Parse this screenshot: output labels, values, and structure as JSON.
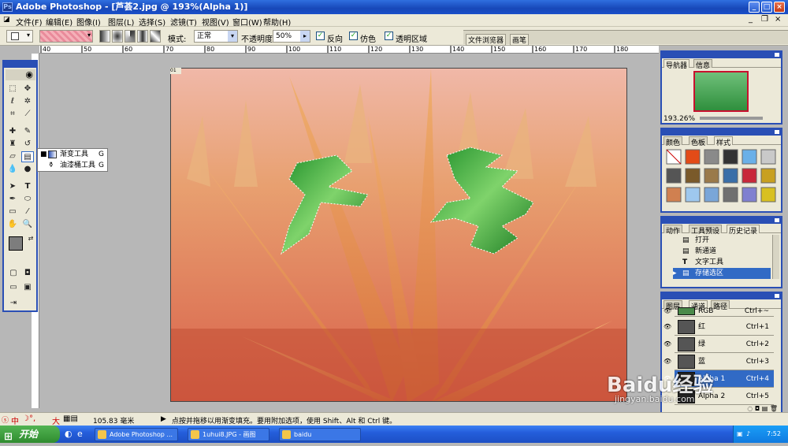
{
  "window": {
    "title": "Adobe Photoshop - [芦荟2.jpg @ 193%(Alpha 1)]"
  },
  "menu": [
    "文件(F)",
    "编辑(E)",
    "图像(I)",
    "图层(L)",
    "选择(S)",
    "滤镜(T)",
    "视图(V)",
    "窗口(W)",
    "帮助(H)"
  ],
  "options": {
    "mode_label": "模式:",
    "mode_value": "正常",
    "opacity_label": "不透明度:",
    "opacity_value": "50%",
    "reverse_label": "反向",
    "dither_label": "仿色",
    "transparency_label": "透明区域",
    "palette_tab1": "文件浏览器",
    "palette_tab2": "画笔"
  },
  "ruler_ticks": [
    "40",
    "50",
    "60",
    "70",
    "80",
    "90",
    "100",
    "110",
    "120",
    "130",
    "140",
    "150",
    "160",
    "170",
    "180"
  ],
  "flyout": {
    "item1_label": "渐变工具",
    "item1_key": "G",
    "item2_label": "油漆桶工具",
    "item2_key": "G"
  },
  "document": {
    "tab_label": "01"
  },
  "navigator": {
    "tab1": "导航器",
    "tab2": "信息",
    "zoom": "193.26%"
  },
  "swatches": {
    "tab1": "颜色",
    "tab2": "色板",
    "tab3": "样式"
  },
  "history": {
    "tab1": "动作",
    "tab2": "工具预设",
    "tab3": "历史记录",
    "items": [
      {
        "label": "打开"
      },
      {
        "label": "新通道"
      },
      {
        "label": "文字工具"
      },
      {
        "label": "存储选区"
      }
    ]
  },
  "channels": {
    "tab1": "图层",
    "tab2": "通道",
    "tab3": "路径",
    "rows": [
      {
        "name": "RGB",
        "key": "Ctrl+~"
      },
      {
        "name": "红",
        "key": "Ctrl+1"
      },
      {
        "name": "绿",
        "key": "Ctrl+2"
      },
      {
        "name": "蓝",
        "key": "Ctrl+3"
      },
      {
        "name": "Alpha 1",
        "key": "Ctrl+4"
      },
      {
        "name": "Alpha 2",
        "key": "Ctrl+5"
      }
    ]
  },
  "status": {
    "ime": "中",
    "ime_width": "大",
    "dimensions": "105.83 毫米",
    "hint": "点按并拖移以用渐变填充。要用附加选项，使用 Shift、Alt 和 Ctrl 键。"
  },
  "taskbar": {
    "start": "开始",
    "tasks": [
      "Adobe Photoshop ...",
      "1uhui8.JPG - 画图",
      "baidu"
    ],
    "clock": "7:52"
  },
  "watermark": {
    "text": "Baidu经验",
    "url": "jingyan.baidu.com"
  },
  "colors": {
    "title_blue": "#1a4fc9",
    "panel_border": "#2a4fb5",
    "chrome": "#ece9d8",
    "selection": "#316ac5"
  }
}
